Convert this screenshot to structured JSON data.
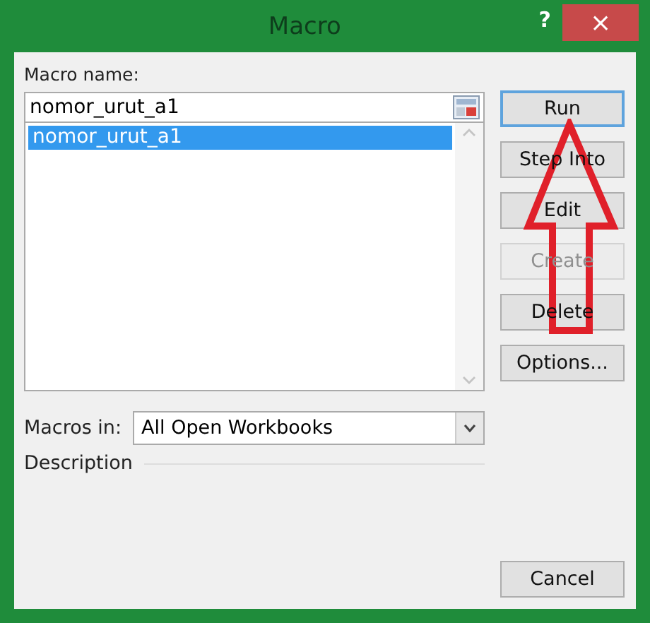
{
  "window": {
    "title": "Macro",
    "help": "?",
    "close": "×"
  },
  "macro_name": {
    "label": "Macro name:",
    "value": "nomor_urut_a1"
  },
  "macros": [
    {
      "name": "nomor_urut_a1",
      "selected": true
    }
  ],
  "buttons": [
    {
      "label": "Run",
      "disabled": false
    },
    {
      "label": "Step Into",
      "disabled": false
    },
    {
      "label": "Edit",
      "disabled": false
    },
    {
      "label": "Create",
      "disabled": true
    },
    {
      "label": "Delete",
      "disabled": false
    },
    {
      "label": "Options...",
      "disabled": false
    }
  ],
  "macros_in": {
    "label": "Macros in:",
    "value": "All Open Workbooks"
  },
  "description": {
    "label": "Description"
  },
  "cancel": "Cancel",
  "annotation": {
    "kind": "arrow"
  }
}
